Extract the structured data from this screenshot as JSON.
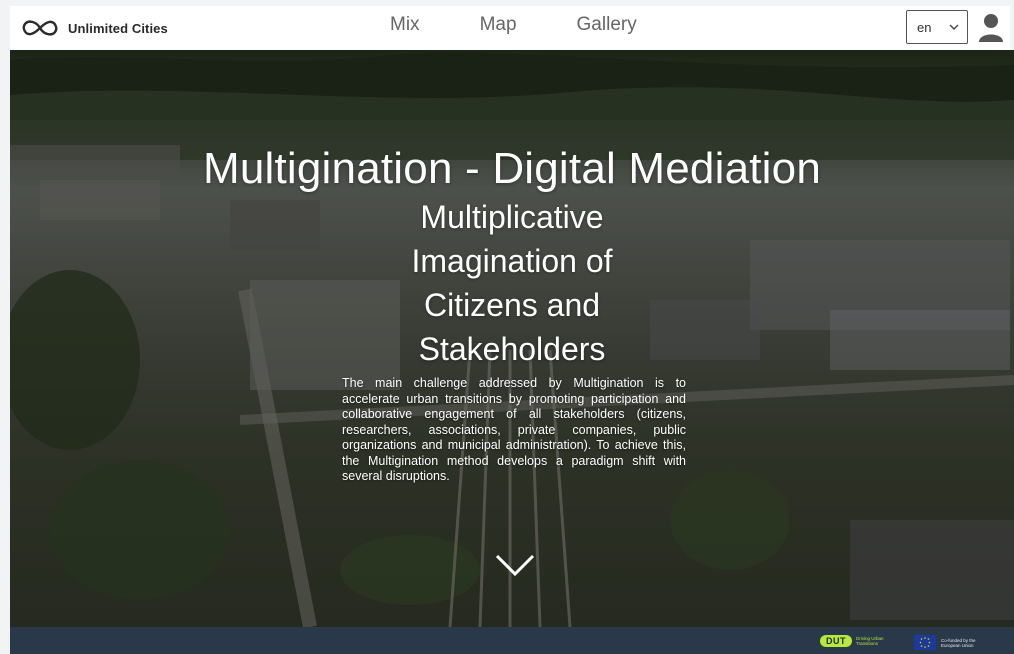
{
  "header": {
    "brand_name": "Unlimited Cities",
    "nav": [
      {
        "label": "Mix"
      },
      {
        "label": "Map"
      },
      {
        "label": "Gallery"
      }
    ],
    "language": "en",
    "icons": {
      "logo": "infinity-icon",
      "language_caret": "chevron-down-icon",
      "account": "user-icon"
    }
  },
  "hero": {
    "title": "Multigination - Digital Mediation",
    "subtitle": "Multiplicative Imagination of Citizens and Stakeholders",
    "description": "The main challenge addressed by Multigination is to accelerate urban transitions by promoting participation and collaborative engagement of all stakeholders (citizens, researchers, associations, private companies, public organizations and municipal administration). To achieve this, the Multigination method develops a paradigm shift with several disruptions.",
    "scroll_icon": "chevron-down-icon"
  },
  "footer": {
    "dut_badge": "DUT",
    "dut_text": "Driving Urban Transitions",
    "eu_text": "Co-funded by the European Union"
  },
  "colors": {
    "footer_bg": "#29394a",
    "dut_accent": "#b9e83d",
    "eu_blue": "#1b3a9c",
    "header_bg": "#ffffff"
  }
}
